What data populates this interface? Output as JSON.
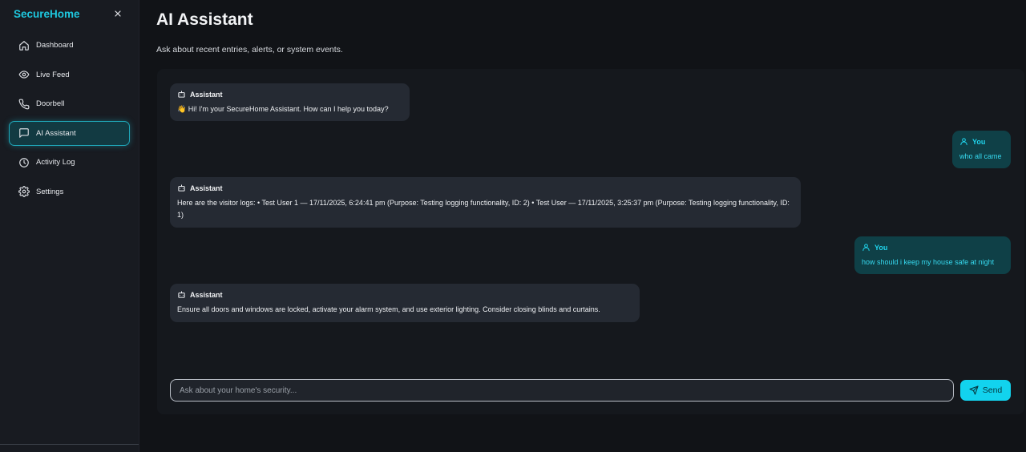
{
  "sidebar": {
    "brand": "SecureHome",
    "close_icon": "close-icon",
    "items": [
      {
        "label": "Dashboard",
        "icon": "home-icon",
        "active": false
      },
      {
        "label": "Live Feed",
        "icon": "eye-icon",
        "active": false
      },
      {
        "label": "Doorbell",
        "icon": "phone-icon",
        "active": false
      },
      {
        "label": "AI Assistant",
        "icon": "message-square-icon",
        "active": true
      },
      {
        "label": "Activity Log",
        "icon": "clock-icon",
        "active": false
      },
      {
        "label": "Settings",
        "icon": "gear-icon",
        "active": false
      }
    ]
  },
  "header": {
    "title": "AI Assistant",
    "subtitle": "Ask about recent entries, alerts, or system events."
  },
  "messages": [
    {
      "role": "assistant",
      "sender": "Assistant",
      "icon": "bot-icon",
      "emoji": "👋",
      "text": "Hi! I'm your SecureHome Assistant. How can I help you today?"
    },
    {
      "role": "user",
      "sender": "You",
      "icon": "user-icon",
      "text": "who all came"
    },
    {
      "role": "assistant",
      "sender": "Assistant",
      "icon": "bot-icon",
      "text": "Here are the visitor logs: • Test User 1 — 17/11/2025, 6:24:41 pm (Purpose: Testing logging functionality, ID: 2) • Test User — 17/11/2025, 3:25:37 pm (Purpose: Testing logging functionality, ID: 1)"
    },
    {
      "role": "user",
      "sender": "You",
      "icon": "user-icon",
      "text": "how should i keep my house safe at night"
    },
    {
      "role": "assistant",
      "sender": "Assistant",
      "icon": "bot-icon",
      "text": "Ensure all doors and windows are locked, activate your alarm system, and use exterior lighting. Consider closing blinds and curtains."
    }
  ],
  "composer": {
    "placeholder": "Ask about your home's security...",
    "value": "",
    "send_label": "Send",
    "send_icon": "send-icon"
  },
  "colors": {
    "accent": "#1ec8df",
    "background": "#111317",
    "sidebar": "#181b21",
    "assistant_bubble": "#252a33",
    "user_bubble": "#0f4047"
  }
}
